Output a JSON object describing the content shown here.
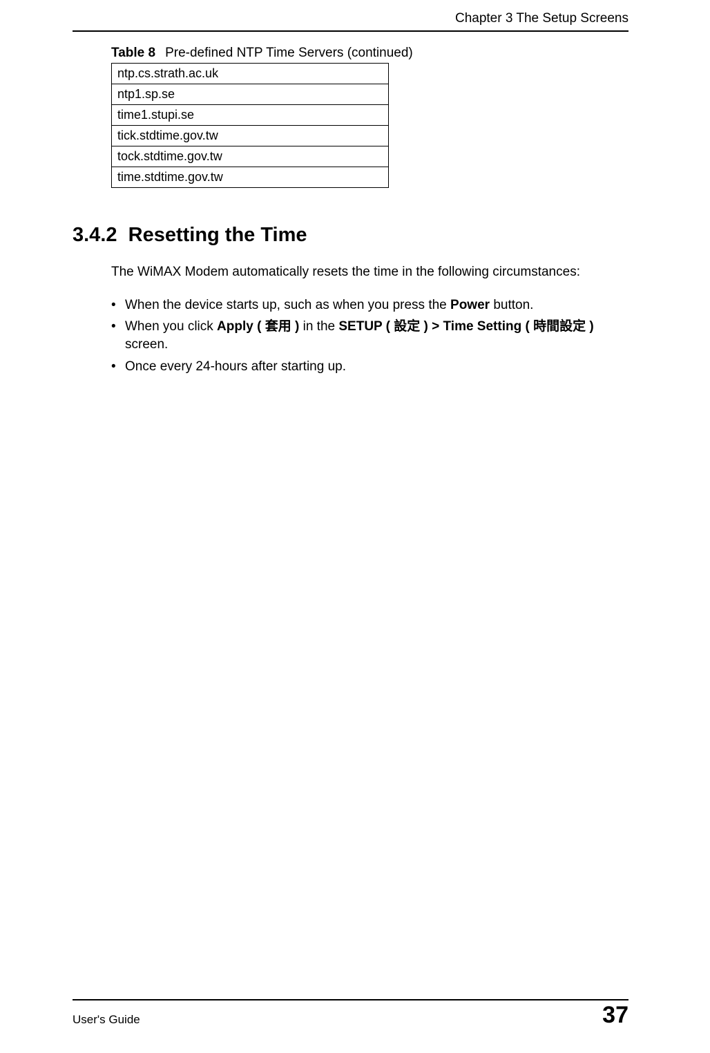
{
  "header": {
    "chapter": "Chapter 3 The Setup Screens"
  },
  "table": {
    "label": "Table 8",
    "caption": "Pre-defined NTP Time Servers (continued)",
    "rows": [
      "ntp.cs.strath.ac.uk",
      "ntp1.sp.se",
      "time1.stupi.se",
      "tick.stdtime.gov.tw",
      "tock.stdtime.gov.tw",
      "time.stdtime.gov.tw"
    ]
  },
  "section": {
    "number": "3.4.2",
    "title": "Resetting the Time",
    "intro": "The WiMAX Modem automatically resets the time in the following circumstances:",
    "bullets": {
      "b1": {
        "pre": "When the device starts up, such as when you press the ",
        "bold1": "Power",
        "post": " button."
      },
      "b2": {
        "pre": "When you click ",
        "bold1": "Apply ( 套用 )",
        "mid1": " in the ",
        "bold2": "SETUP  ( 設定 ) > Time Setting ( 時間設定 )",
        "post": " screen."
      },
      "b3": {
        "text": "Once every 24-hours after starting up."
      }
    }
  },
  "footer": {
    "left": "User's Guide",
    "right": "37"
  }
}
